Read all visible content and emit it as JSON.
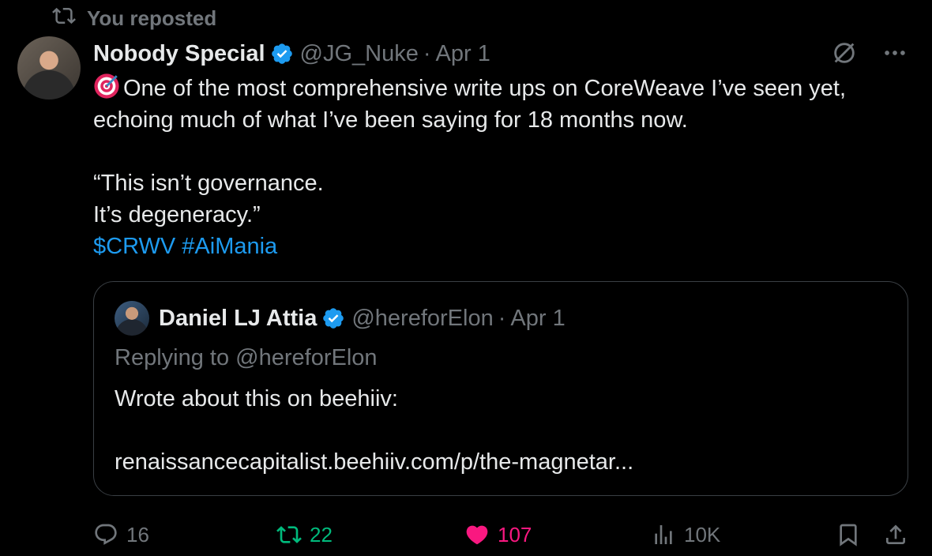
{
  "repost_banner": {
    "text": "You reposted"
  },
  "tweet": {
    "author_name": "Nobody Special",
    "handle": "@JG_Nuke",
    "separator": "·",
    "date": "Apr 1",
    "text_line1": "One of the most comprehensive write ups on CoreWeave I’ve seen yet,",
    "text_line2": "echoing much of what I’ve been saying for 18 months now.",
    "text_line3": "",
    "text_line4": "“This isn’t governance.",
    "text_line5": "It’s degeneracy.”",
    "cashtag": "$CRWV",
    "hashtag": "#AiMania"
  },
  "quote": {
    "author_name": "Daniel LJ Attia",
    "handle": "@hereforElon",
    "separator": "·",
    "date": "Apr 1",
    "replying_prefix": "Replying to ",
    "replying_handle": "@hereforElon",
    "body_line1": "Wrote about this on beehiiv:",
    "body_line2": "",
    "body_line3": "renaissancecapitalist.beehiiv.com/p/the-magnetar..."
  },
  "actions": {
    "replies": "16",
    "reposts": "22",
    "likes": "107",
    "views": "10K"
  },
  "icons": {
    "repost": "repost-icon",
    "verified": "verified-badge-icon",
    "grok": "grok-icon",
    "more": "more-icon",
    "reply": "reply-icon",
    "like": "heart-icon",
    "views": "views-icon",
    "bookmark": "bookmark-icon",
    "share": "share-icon",
    "target": "target-emoji-icon"
  },
  "colors": {
    "background": "#000000",
    "text": "#e7e9ea",
    "muted": "#71767b",
    "link": "#1d9bf0",
    "repost_active": "#00ba7c",
    "like_active": "#f91880",
    "verified": "#1d9bf0"
  }
}
